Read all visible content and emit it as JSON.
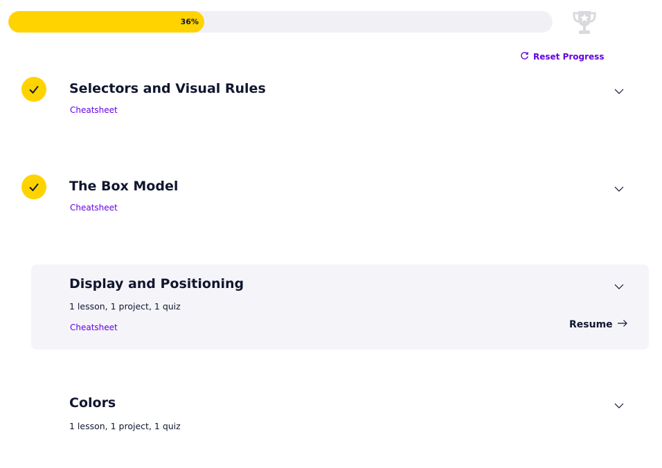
{
  "progress": {
    "percent_label": "36%",
    "fraction": 0.36
  },
  "reset_label": "Reset Progress",
  "modules": [
    {
      "title": "Selectors and Visual Rules",
      "completed": true,
      "cheatsheet": "Cheatsheet"
    },
    {
      "title": "The Box Model",
      "completed": true,
      "cheatsheet": "Cheatsheet"
    },
    {
      "title": "Display and Positioning",
      "completed": false,
      "meta": "1 lesson, 1 project, 1 quiz",
      "cheatsheet": "Cheatsheet",
      "resume": "Resume"
    },
    {
      "title": "Colors",
      "completed": false,
      "meta": "1 lesson, 1 project, 1 quiz"
    }
  ],
  "colors": {
    "accent_yellow": "#ffd300",
    "link_purple": "#6400e4",
    "text": "#10162f",
    "card_bg": "#f5f5f9"
  },
  "icons": [
    "trophy-icon",
    "reset-icon",
    "check-icon",
    "chevron-down-icon",
    "arrow-right-icon"
  ]
}
